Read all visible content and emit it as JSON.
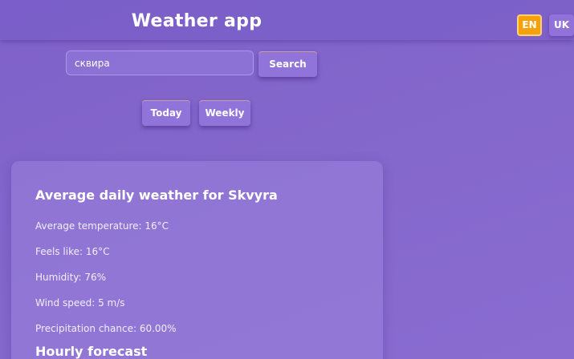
{
  "header": {
    "title": "Weather app",
    "languages": {
      "en": "EN",
      "uk": "UK"
    },
    "active_language": "EN"
  },
  "search": {
    "value": "сквира",
    "button_label": "Search"
  },
  "view_toggle": {
    "today_label": "Today",
    "weekly_label": "Weekly"
  },
  "daily": {
    "title": "Average daily weather for Skvyra",
    "average_temperature": "Average temperature: 16°C",
    "feels_like": "Feels like: 16°C",
    "humidity": "Humidity: 76%",
    "wind_speed": "Wind speed: 5 m/s",
    "precipitation": "Precipitation chance: 60.00%"
  },
  "hourly": {
    "title": "Hourly forecast"
  },
  "colors": {
    "accent": "#f5a10a",
    "background": "#8467cb"
  }
}
